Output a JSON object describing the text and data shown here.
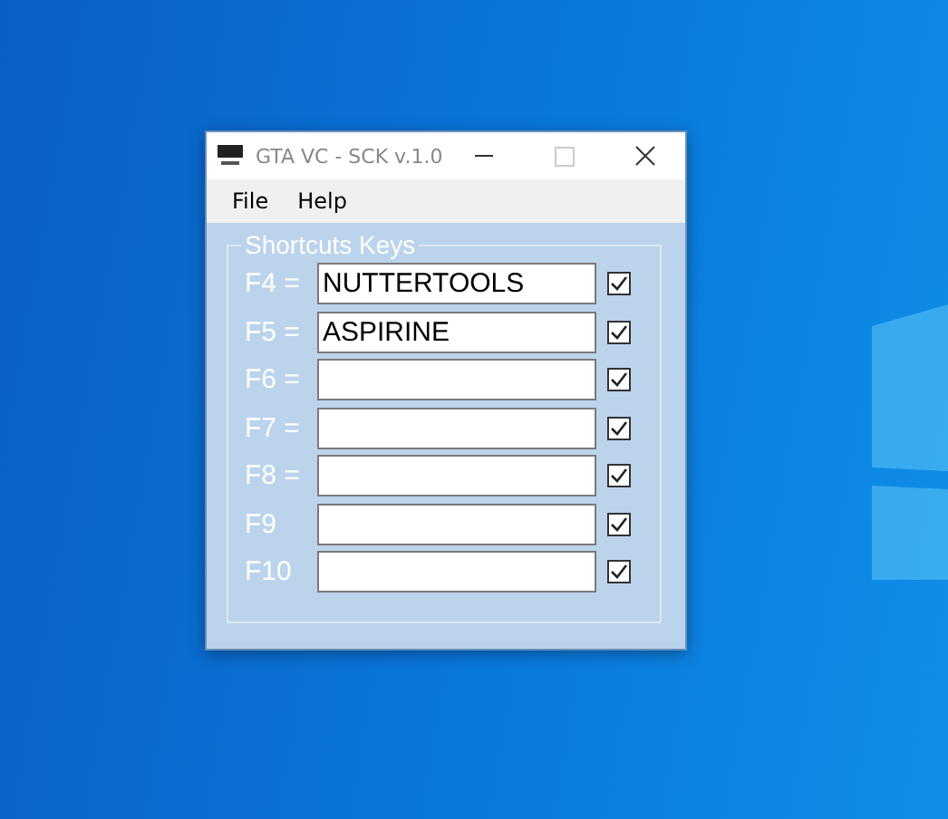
{
  "window": {
    "title": "GTA VC - SCK v.1.0"
  },
  "menu": [
    "File",
    "Help"
  ],
  "group": {
    "title": "Shortcuts Keys"
  },
  "shortcuts": [
    {
      "key": "F4 =",
      "value": "NUTTERTOOLS",
      "checked": true
    },
    {
      "key": "F5 =",
      "value": "ASPIRINE",
      "checked": true
    },
    {
      "key": "F6 =",
      "checked": true
    },
    {
      "key": "F7 =",
      "checked": true
    },
    {
      "key": "F8 =",
      "checked": true
    },
    {
      "key": "F9",
      "checked": true
    },
    {
      "key": "F10",
      "checked": true
    }
  ]
}
